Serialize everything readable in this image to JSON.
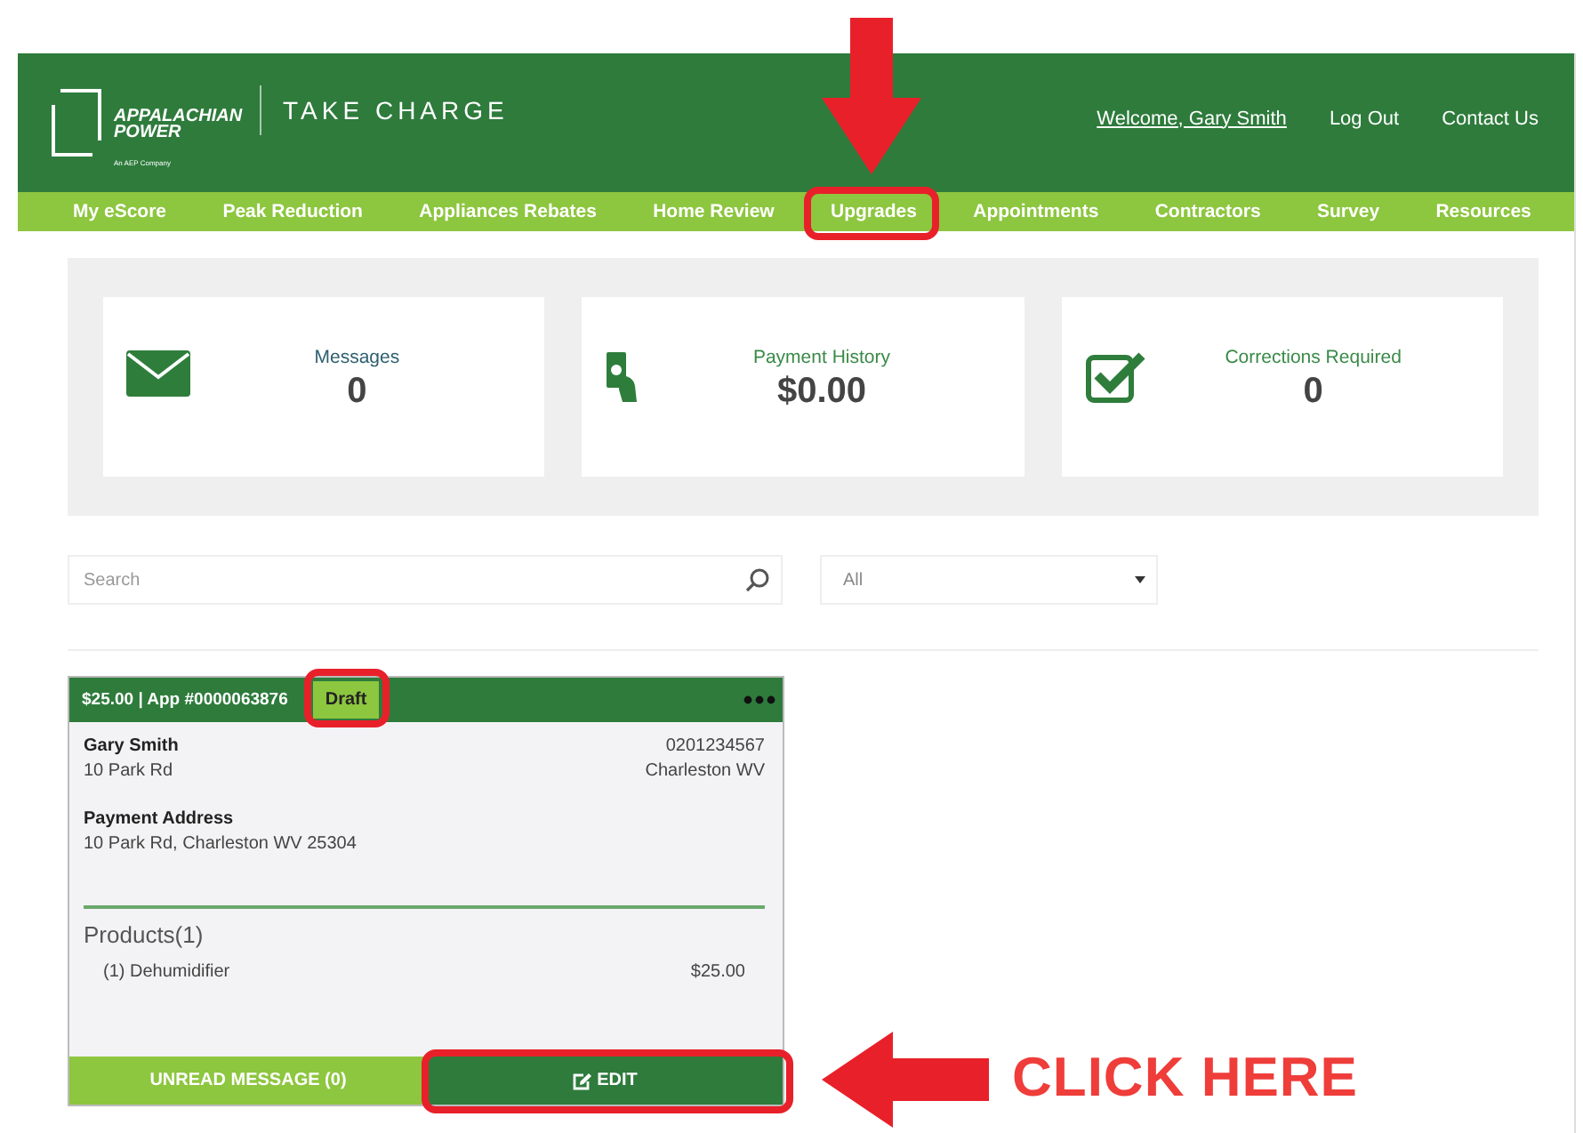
{
  "header": {
    "logo": {
      "brand_lines": [
        "APPALACHIAN",
        "POWER"
      ],
      "tagline": "An AEP Company",
      "product": "TAKE CHARGE"
    },
    "links": [
      {
        "label": "Welcome, Gary Smith",
        "kind": "user"
      },
      {
        "label": "Log Out",
        "kind": "plain"
      },
      {
        "label": "Contact Us",
        "kind": "plain"
      }
    ]
  },
  "nav": [
    "My eScore",
    "Peak Reduction",
    "Appliances Rebates",
    "Home Review",
    "Upgrades",
    "Appointments",
    "Contractors",
    "Survey",
    "Resources"
  ],
  "stats": [
    {
      "kind": "messages",
      "label": "Messages",
      "value": "0"
    },
    {
      "kind": "payment",
      "label": "Payment History",
      "value": "$0.00"
    },
    {
      "kind": "corrections",
      "label": "Corrections Required",
      "value": "0"
    }
  ],
  "filters": {
    "search": {
      "placeholder": "Search"
    },
    "status": {
      "value": "All"
    }
  },
  "application": {
    "title": "$25.00 | App #0000063876",
    "status": "Draft",
    "name": "Gary Smith",
    "street": "10 Park Rd",
    "account": "0201234567",
    "city": "Charleston WV",
    "payment_label": "Payment Address",
    "payment_address": "10 Park Rd, Charleston WV 25304",
    "products_title": "Products(1)",
    "products": [
      {
        "name": "(1) Dehumidifier",
        "price": "$25.00"
      }
    ],
    "unread": "UNREAD MESSAGE (0)",
    "edit": "EDIT"
  },
  "annotation": {
    "callout": "CLICK HERE"
  }
}
